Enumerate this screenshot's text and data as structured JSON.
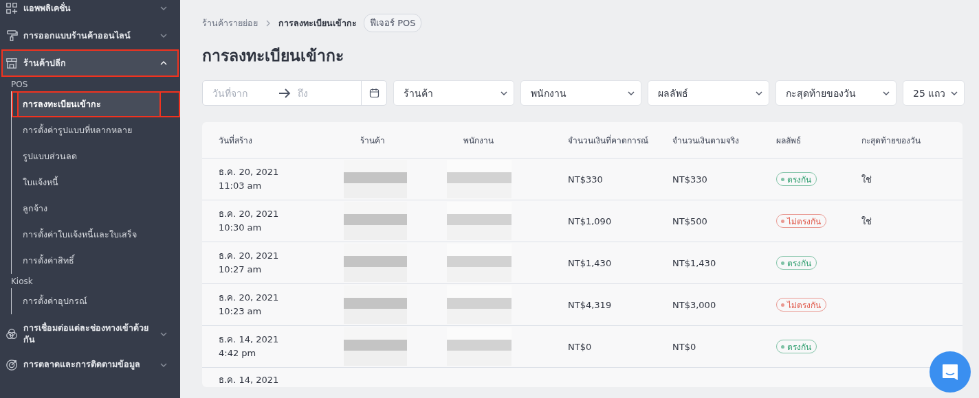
{
  "sidebar": {
    "groups": [
      {
        "kind": "apps",
        "label": "แอพพลิเคชั่น",
        "expanded": false,
        "highlighted": false
      },
      {
        "kind": "paint",
        "label": "การออกแบบร้านค้าออนไลน์",
        "expanded": false,
        "highlighted": false
      },
      {
        "kind": "store",
        "label": "ร้านค้าปลีก",
        "expanded": true,
        "highlighted": true,
        "sections": [
          {
            "title": "POS",
            "items": [
              {
                "label": "การลงทะเบียนเข้ากะ",
                "selected": true,
                "highlighted": true
              },
              {
                "label": "การตั้งค่ารูปแบบที่หลากหลาย",
                "selected": false,
                "highlighted": false
              },
              {
                "label": "รูปแบบส่วนลด",
                "selected": false,
                "highlighted": false
              },
              {
                "label": "ใบแจ้งหนี้",
                "selected": false,
                "highlighted": false
              },
              {
                "label": "ลูกจ้าง",
                "selected": false,
                "highlighted": false
              },
              {
                "label": "การตั้งค่าใบแจ้งหนี้และใบเสร็จ",
                "selected": false,
                "highlighted": false
              },
              {
                "label": "การตั้งค่าสิทธิ์",
                "selected": false,
                "highlighted": false
              }
            ]
          },
          {
            "title": "Kiosk",
            "items": [
              {
                "label": "การตั้งค่าอุปกรณ์",
                "selected": false,
                "highlighted": false
              }
            ]
          }
        ]
      },
      {
        "kind": "circles",
        "label": "การเชื่อมต่อแต่ละช่องทางเข้าด้วยกัน",
        "expanded": false,
        "highlighted": false
      },
      {
        "kind": "target",
        "label": "การตลาดและการติดตามข้อมูล",
        "expanded": false,
        "highlighted": false
      }
    ]
  },
  "breadcrumb": {
    "items": [
      "ร้านค้ารายย่อย",
      "การลงทะเบียนเข้ากะ"
    ],
    "tag": "ฟีเจอร์ POS"
  },
  "title": "การลงทะเบียนเข้ากะ",
  "filters": {
    "date_from": {
      "placeholder": "วันที่จาก"
    },
    "date_to": {
      "placeholder": "ถึง"
    },
    "dropdowns": [
      "ร้านค้า",
      "พนักงาน",
      "ผลลัพธ์",
      "กะสุดท้ายของวัน",
      "25 แถว"
    ]
  },
  "table": {
    "columns": [
      "วันที่สร้าง",
      "ร้านค้า",
      "พนักงาน",
      "จำนวนเงินที่คาดการณ์",
      "จำนวนเงินตามจริง",
      "ผลลัพธ์",
      "กะสุดท้ายของวัน"
    ],
    "rows": [
      {
        "date": "ธ.ค. 20, 2021",
        "time": "11:03 am",
        "expected": "NT$330",
        "actual": "NT$330",
        "result": {
          "kind": "match",
          "label": "ตรงกัน"
        },
        "end_of_day": "ใช่"
      },
      {
        "date": "ธ.ค. 20, 2021",
        "time": "10:30 am",
        "expected": "NT$1,090",
        "actual": "NT$500",
        "result": {
          "kind": "mismatch",
          "label": "ไม่ตรงกัน"
        },
        "end_of_day": "ใช่"
      },
      {
        "date": "ธ.ค. 20, 2021",
        "time": "10:27 am",
        "expected": "NT$1,430",
        "actual": "NT$1,430",
        "result": {
          "kind": "match",
          "label": "ตรงกัน"
        }
      },
      {
        "date": "ธ.ค. 20, 2021",
        "time": "10:23 am",
        "expected": "NT$4,319",
        "actual": "NT$3,000",
        "result": {
          "kind": "mismatch",
          "label": "ไม่ตรงกัน"
        }
      },
      {
        "date": "ธ.ค. 14, 2021",
        "time": "4:42 pm",
        "expected": "NT$0",
        "actual": "NT$0",
        "result": {
          "kind": "match",
          "label": "ตรงกัน"
        }
      },
      {
        "date": "ธ.ค. 14, 2021"
      }
    ]
  }
}
